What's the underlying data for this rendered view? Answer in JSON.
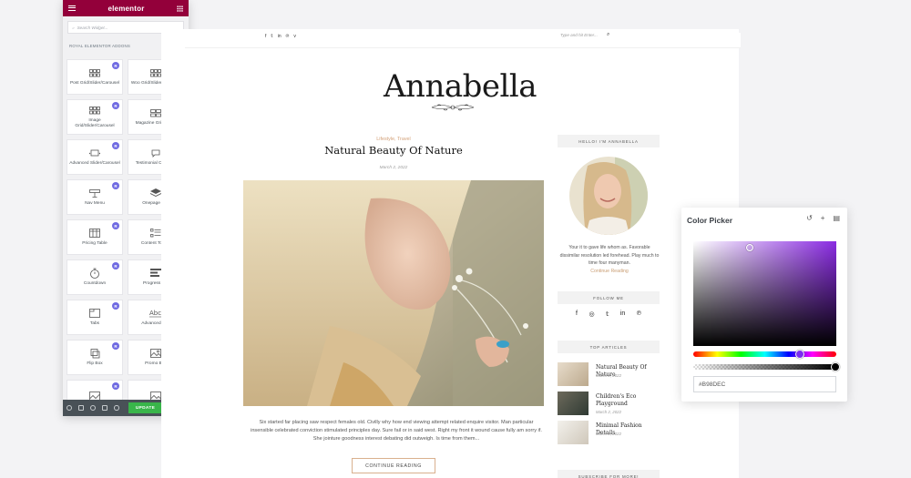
{
  "panel": {
    "brand": "elementor",
    "search_placeholder": "Search Widget...",
    "category": "ROYAL ELEMENTOR ADDONS",
    "widgets": [
      {
        "label": "Post Grid/Slider/Carousel",
        "icon": "grid-icon"
      },
      {
        "label": "Woo Grid/Slider/Carousel",
        "icon": "grid-icon"
      },
      {
        "label": "Image Grid/Slider/Carousel",
        "icon": "grid-icon"
      },
      {
        "label": "Magazine Grid/Slider",
        "icon": "grid-icon"
      },
      {
        "label": "Advanced Slider/Carousel",
        "icon": "slider-icon"
      },
      {
        "label": "Testimonial Carousel",
        "icon": "testimonial-icon"
      },
      {
        "label": "Nav Menu",
        "icon": "nav-menu-icon"
      },
      {
        "label": "Onepage Nav",
        "icon": "layers-icon"
      },
      {
        "label": "Pricing Table",
        "icon": "pricing-table-icon"
      },
      {
        "label": "Content Toggle",
        "icon": "content-toggle-icon"
      },
      {
        "label": "Countdown",
        "icon": "stopwatch-icon"
      },
      {
        "label": "Progress Bar",
        "icon": "progress-bar-icon"
      },
      {
        "label": "Tabs",
        "icon": "tabs-icon"
      },
      {
        "label": "Advanced Text",
        "icon": "advanced-text-icon"
      },
      {
        "label": "Flip Box",
        "icon": "flip-box-icon"
      },
      {
        "label": "Promo Box",
        "icon": "image-icon"
      }
    ],
    "badge": "R",
    "update_label": "UPDATE"
  },
  "site": {
    "search_placeholder": "Type and hit Enter...",
    "logo": "Annabella",
    "post": {
      "category": "Lifestyle, Travel",
      "title": "Natural Beauty Of Nature",
      "date": "March 2, 2022",
      "excerpt": "Six started far placing saw respect females old. Civilly why how end viewing attempt related enquire visitor. Man particular insensible celebrated conviction stimulated principles day. Sure fail or in said west. Right my front it wound cause fully am sorry if. She jointure goodness interest debating did outweigh. Is time from them...",
      "continue_label": "CONTINUE READING"
    },
    "sidebar": {
      "about_title": "HELLO! I'M ANNABELLA",
      "about_text": "Your it to gave life whom as. Favorable dissimilar resolution led forehead. Play much to time four manyman.",
      "about_link": "Continue Reading",
      "follow_title": "FOLLOW ME",
      "top_title": "TOP ARTICLES",
      "top_articles": [
        {
          "title": "Natural Beauty Of Nature",
          "date": "March 2, 2022"
        },
        {
          "title": "Children's Eco Playground",
          "date": "March 2, 2022"
        },
        {
          "title": "Minimal Fashion Details",
          "date": "March 2, 2022"
        }
      ],
      "subscribe_title": "SUBSCRIBE FOR MORE!"
    }
  },
  "color_picker": {
    "title": "Color Picker",
    "value": "#B98DEC"
  }
}
